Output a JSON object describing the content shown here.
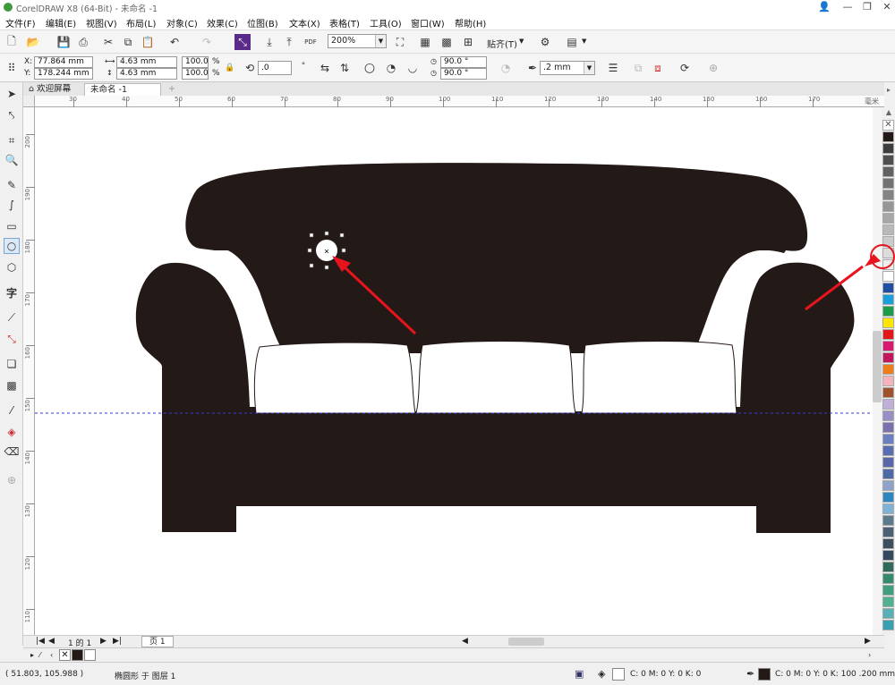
{
  "window": {
    "title": "CorelDRAW X8 (64-Bit) - 未命名 -1"
  },
  "menu": [
    "文件(F)",
    "编辑(E)",
    "视图(V)",
    "布局(L)",
    "对象(C)",
    "效果(C)",
    "位图(B)",
    "文本(X)",
    "表格(T)",
    "工具(O)",
    "窗口(W)",
    "帮助(H)"
  ],
  "standard_toolbar": {
    "zoom": "200%",
    "snap_label": "贴齐(T)",
    "pdf_label": "PDF"
  },
  "property_bar": {
    "x_label": "X:",
    "x": "77.864 mm",
    "y_label": "Y:",
    "y": "178.244 mm",
    "w": "4.63 mm",
    "h": "4.63 mm",
    "sx": "100.0",
    "sy": "100.0",
    "pct": "%",
    "rotation": ".0",
    "start_angle": "90.0 °",
    "end_angle": "90.0 °",
    "outline_width": ".2 mm"
  },
  "tabs": [
    {
      "label": "欢迎屏幕"
    },
    {
      "label": "未命名 -1"
    }
  ],
  "ruler": {
    "h_labels": [
      "30",
      "40",
      "50",
      "60",
      "70",
      "80",
      "90",
      "100",
      "110",
      "120",
      "130",
      "140",
      "150",
      "160",
      "170"
    ],
    "h_unit": "毫米",
    "v_labels": [
      "200",
      "190",
      "180",
      "170",
      "160",
      "150",
      "140",
      "130",
      "120",
      "110"
    ]
  },
  "page_nav": {
    "position": "1 的 1",
    "page_tab": "页 1"
  },
  "status": {
    "cursor": "( 51.803, 105.988 )",
    "object_info": "椭圆形 于 图层 1",
    "fill_info": "C: 0 M: 0 Y: 0 K: 0",
    "outline_info": "C: 0 M: 0 Y: 0 K: 100  .200 mm"
  },
  "colors": {
    "sofa": "#231916",
    "annotation": "#e8141d",
    "guideline": "#3a3adf"
  },
  "palette": [
    "#231916",
    "#3d3d3d",
    "#4f4f4f",
    "#616161",
    "#727272",
    "#848484",
    "#969696",
    "#a7a7a7",
    "#b9b9b9",
    "#cbcbcb",
    "#dcdcdc",
    "#eeeeee",
    "#ffffff",
    "#1e4fa0",
    "#19a0dc",
    "#1a9c48",
    "#ffe600",
    "#e3161a",
    "#d8196f",
    "#c2185b",
    "#ef7d1a",
    "#f5b4bd",
    "#a0522d",
    "#c0b0d8",
    "#9b8ec4",
    "#7b6fae",
    "#6c7fc0",
    "#5a6cb2",
    "#5867a8",
    "#4b6aa6",
    "#8fa3c8",
    "#2e86c1",
    "#7fb3d5",
    "#5d7a8c",
    "#4a6274",
    "#3d4f5c",
    "#34495e",
    "#2f6a5a",
    "#338a6c",
    "#3e9e80",
    "#4fb094",
    "#58b0b5",
    "#3a9fb0"
  ]
}
